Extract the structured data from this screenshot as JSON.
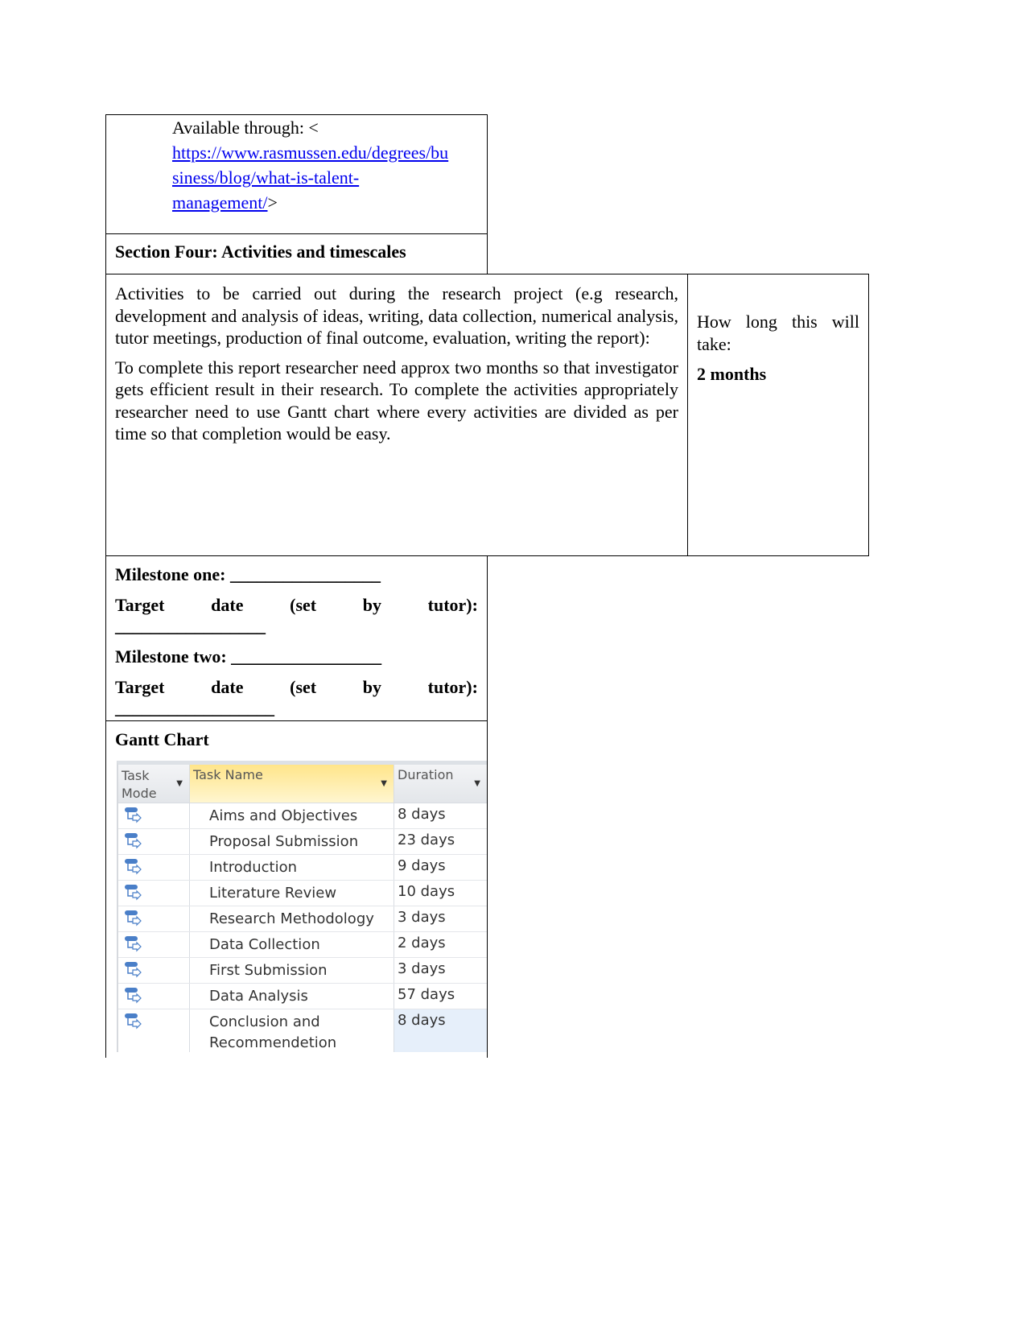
{
  "source": {
    "prefix": "Available through: <",
    "link": "https://www.rasmussen.edu/degrees/business/blog/what-is-talent-management/",
    "link_lines": [
      "https://www.rasmussen.edu/degrees/bu",
      "siness/blog/what-is-talent-",
      "management/"
    ],
    "suffix": ">"
  },
  "section_title": "Section Four: Activities and timescales",
  "activities": {
    "prompt": "Activities to be carried out during the research project (e.g research, development and analysis of ideas, writing, data collection, numerical analysis, tutor meetings, production of final outcome, evaluation, writing the report):",
    "answer": "To complete this report researcher need approx two months so that investigator gets efficient result in their research. To complete the activities appropriately researcher need to use Gantt chart where every activities are divided as per time so that completion would be easy."
  },
  "duration": {
    "prompt": "How long this will take:",
    "answer": "2 months"
  },
  "milestones": {
    "one": "Milestone one: _________________",
    "two": "Milestone two: _________________",
    "target_words": [
      "Target",
      "date",
      "(set",
      "by",
      "tutor):"
    ],
    "blank1": "_________________",
    "blank2": "__________________"
  },
  "gantt": {
    "title": "Gantt Chart",
    "headers": [
      "Task Mode",
      "Task Name",
      "Duration"
    ],
    "rows": [
      {
        "name": "Aims and Objectives",
        "duration": "8 days"
      },
      {
        "name": "Proposal Submission",
        "duration": "23 days"
      },
      {
        "name": "Introduction",
        "duration": "9 days"
      },
      {
        "name": "Literature Review",
        "duration": "10 days"
      },
      {
        "name": "Research Methodology",
        "duration": "3 days"
      },
      {
        "name": "Data Collection",
        "duration": "2 days"
      },
      {
        "name": "First Submission",
        "duration": "3 days"
      },
      {
        "name": "Data Analysis",
        "duration": "57 days"
      },
      {
        "name": "Conclusion and Recommendetion",
        "duration": "8 days"
      }
    ]
  }
}
